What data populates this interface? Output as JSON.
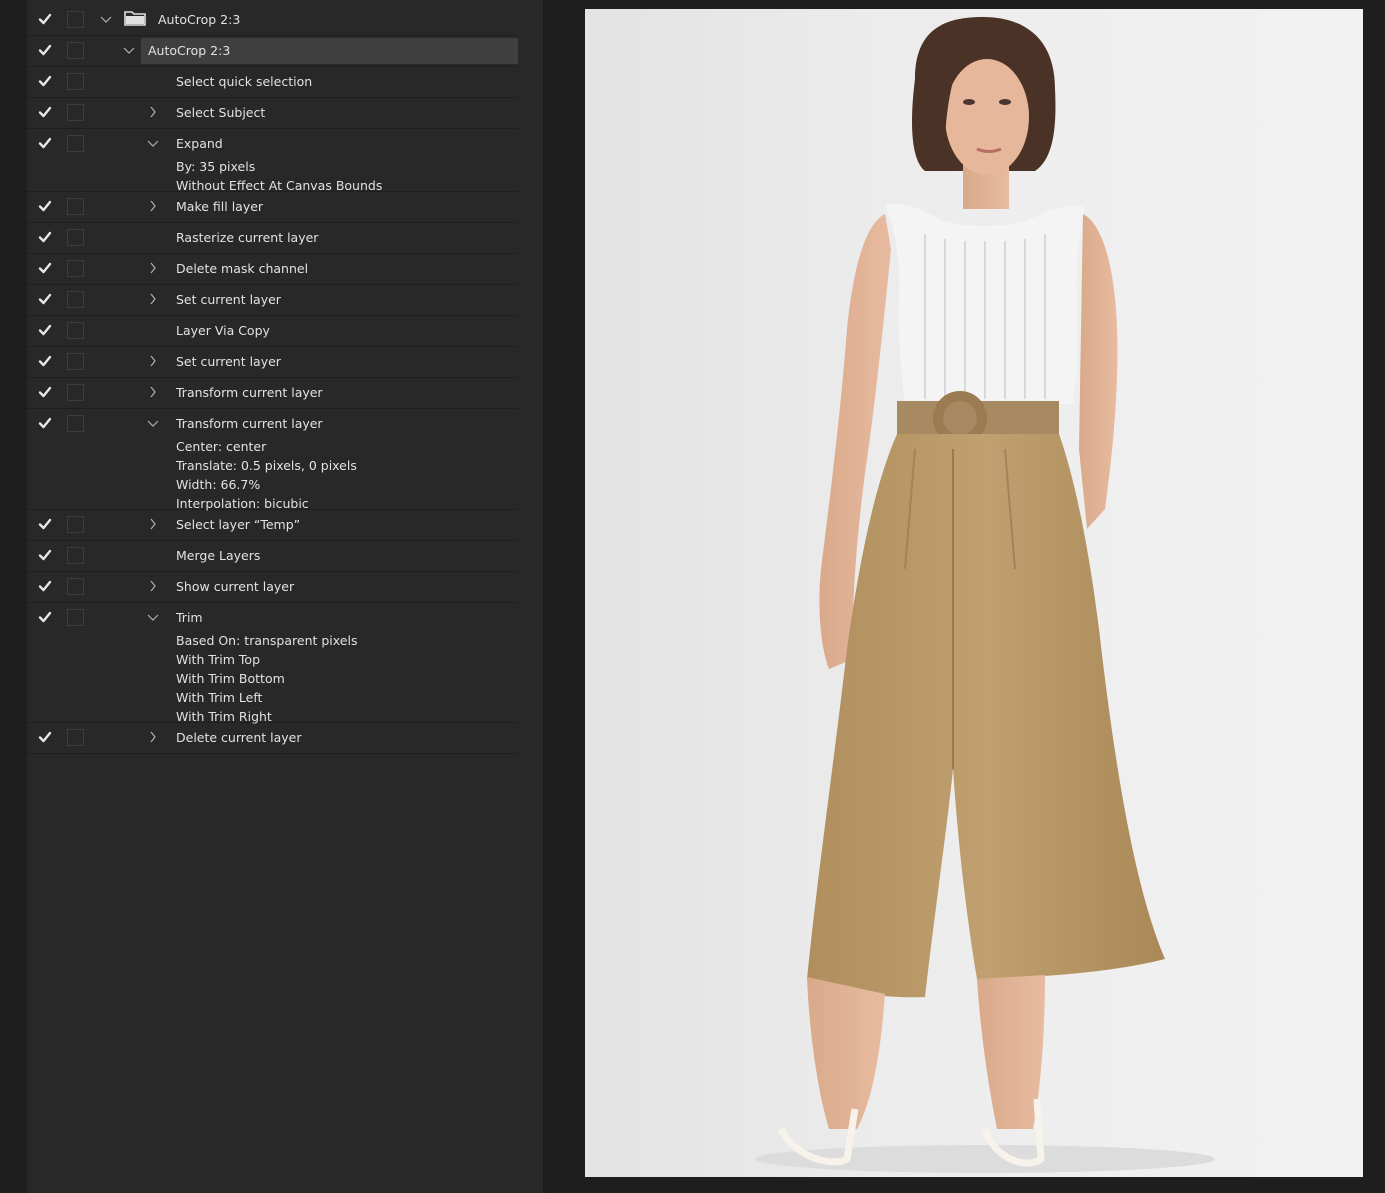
{
  "panel": {
    "rows": [
      {
        "label": "AutoCrop 2:3",
        "type": "set"
      },
      {
        "label": "AutoCrop 2:3",
        "type": "action",
        "selected": true
      },
      {
        "label": "Select quick selection",
        "twisty": "none"
      },
      {
        "label": "Select Subject",
        "twisty": "closed"
      },
      {
        "label": "Expand",
        "twisty": "open",
        "details": [
          "By: 35 pixels",
          "Without Effect At Canvas Bounds"
        ]
      },
      {
        "label": "Make fill layer",
        "twisty": "closed"
      },
      {
        "label": "Rasterize current layer",
        "twisty": "none"
      },
      {
        "label": "Delete mask channel",
        "twisty": "closed"
      },
      {
        "label": "Set current layer",
        "twisty": "closed"
      },
      {
        "label": "Layer Via Copy",
        "twisty": "none"
      },
      {
        "label": "Set current layer",
        "twisty": "closed"
      },
      {
        "label": "Transform current layer",
        "twisty": "closed"
      },
      {
        "label": "Transform current layer",
        "twisty": "open",
        "details": [
          "Center: center",
          "Translate: 0.5 pixels, 0 pixels",
          "Width: 66.7%",
          "Interpolation: bicubic"
        ]
      },
      {
        "label": "Select layer “Temp”",
        "twisty": "closed"
      },
      {
        "label": "Merge Layers",
        "twisty": "none"
      },
      {
        "label": "Show current layer",
        "twisty": "closed"
      },
      {
        "label": "Trim",
        "twisty": "open",
        "details": [
          "Based On: transparent pixels",
          "With Trim Top",
          "With Trim Bottom",
          "With Trim Left",
          "With Trim Right"
        ]
      },
      {
        "label": "Delete current layer",
        "twisty": "closed"
      }
    ]
  },
  "icons": {
    "check": "checkmark-icon",
    "toggle": "dialog-toggle-box",
    "folder": "folder-icon",
    "open": "chevron-down-icon",
    "closed": "chevron-right-icon"
  },
  "colors": {
    "panel": "#282828",
    "selected_row": "#3f3f3f",
    "text": "#e2e2e2"
  },
  "canvas": {
    "image": "model-photo"
  }
}
